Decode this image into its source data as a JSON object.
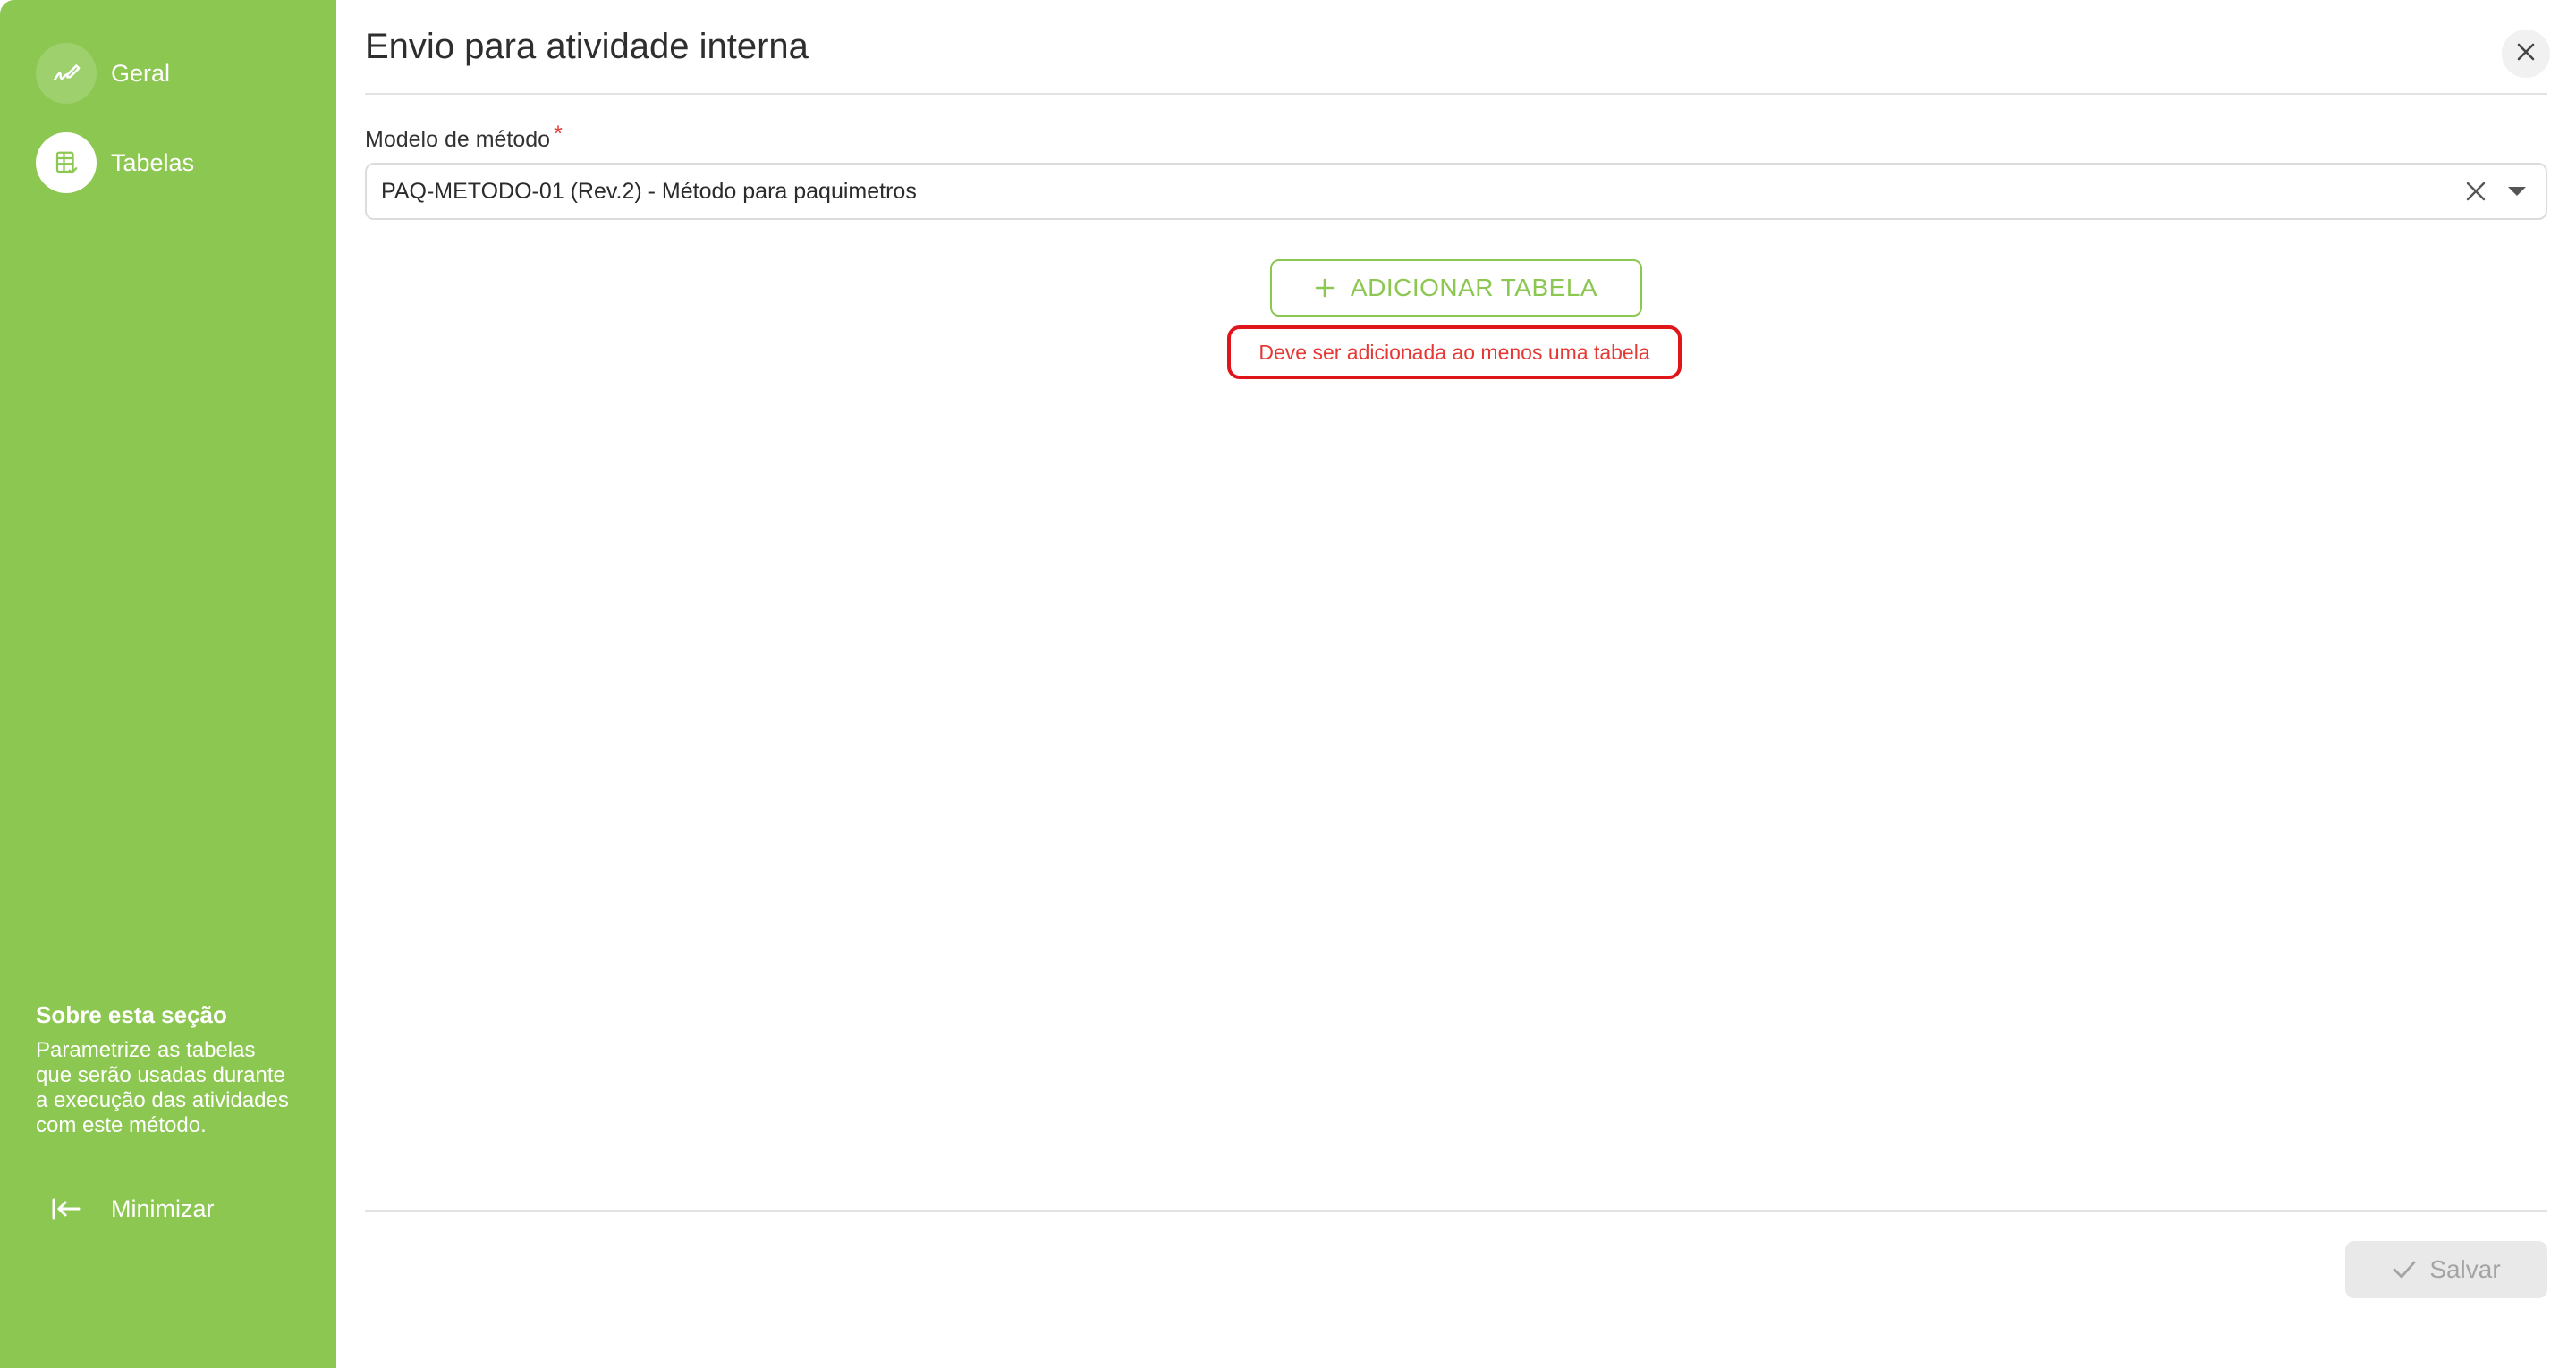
{
  "sidebar": {
    "items": [
      {
        "label": "Geral",
        "icon": "pen-signature-icon",
        "active": false
      },
      {
        "label": "Tabelas",
        "icon": "table-check-icon",
        "active": true
      }
    ],
    "about": {
      "title": "Sobre esta seção",
      "text": "Parametrize as tabelas que serão usadas durante a execução das atividades com este método."
    },
    "minimize_label": "Minimizar"
  },
  "dialog": {
    "title": "Envio para atividade interna",
    "field": {
      "label": "Modelo de método",
      "required_mark": "*",
      "value": "PAQ-METODO-01 (Rev.2) - Método para paquimetros"
    },
    "add_table_label": "ADICIONAR TABELA",
    "error_message": "Deve ser adicionada ao menos uma tabela",
    "save_label": "Salvar",
    "save_disabled": true
  },
  "colors": {
    "accent": "#8cc751",
    "error": "#e53935",
    "error_border": "#e0141b",
    "disabled_bg": "#e9e9e9",
    "disabled_text": "#a4a4a4"
  }
}
